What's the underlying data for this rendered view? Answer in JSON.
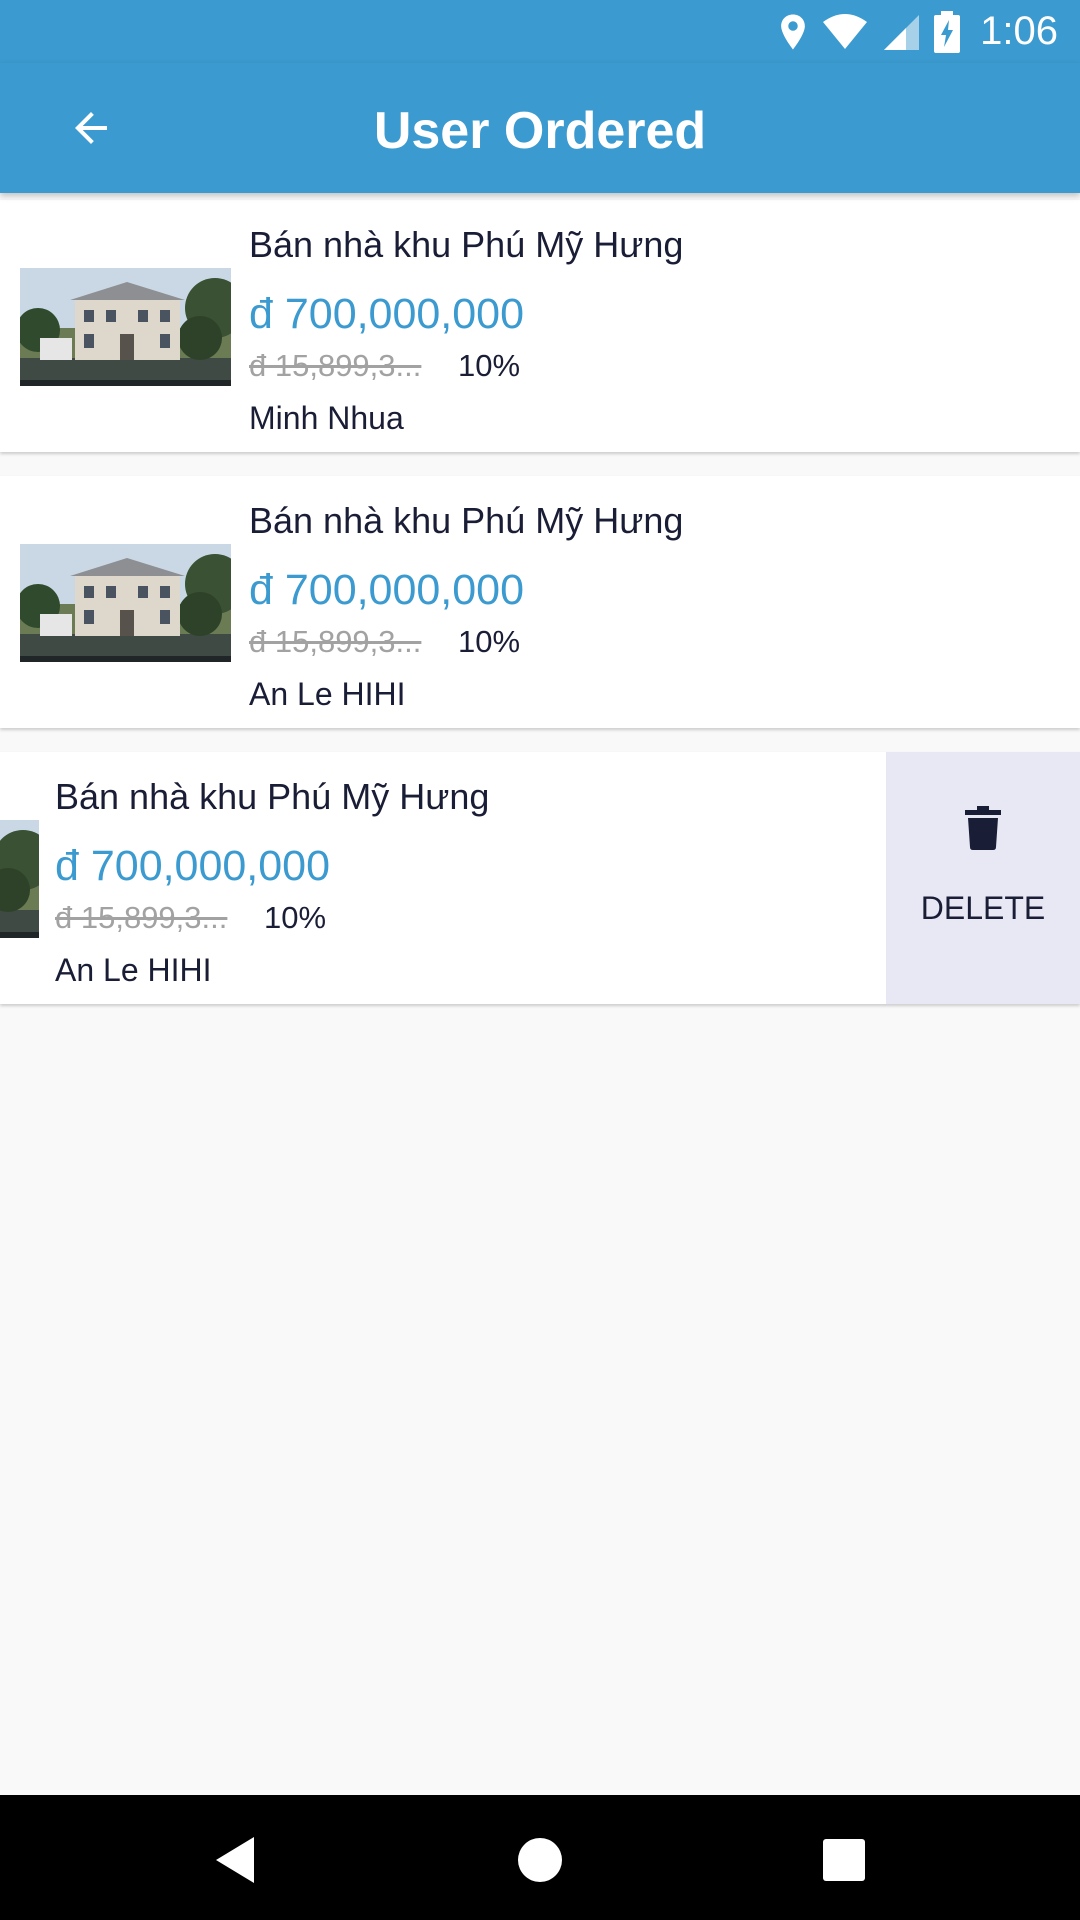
{
  "status_bar": {
    "time": "1:06"
  },
  "app_bar": {
    "title": "User Ordered"
  },
  "orders": [
    {
      "title": "Bán nhà khu Phú Mỹ Hưng",
      "price": "đ 700,000,000",
      "original_price": "đ 15,899,3...",
      "discount": "10%",
      "user": "Minh Nhua"
    },
    {
      "title": "Bán nhà khu Phú Mỹ Hưng",
      "price": "đ 700,000,000",
      "original_price": "đ 15,899,3...",
      "discount": "10%",
      "user": "An Le HIHI"
    },
    {
      "title": "Bán nhà khu Phú Mỹ Hưng",
      "price": "đ 700,000,000",
      "original_price": "đ 15,899,3...",
      "discount": "10%",
      "user": "An Le HIHI"
    }
  ],
  "swipe_action": {
    "label": "DELETE",
    "icon": "trash-icon"
  },
  "colors": {
    "primary": "#3b9acf",
    "text": "#1a1d36",
    "muted": "#a2a2a2",
    "delete_bg": "#e8e8f5"
  }
}
